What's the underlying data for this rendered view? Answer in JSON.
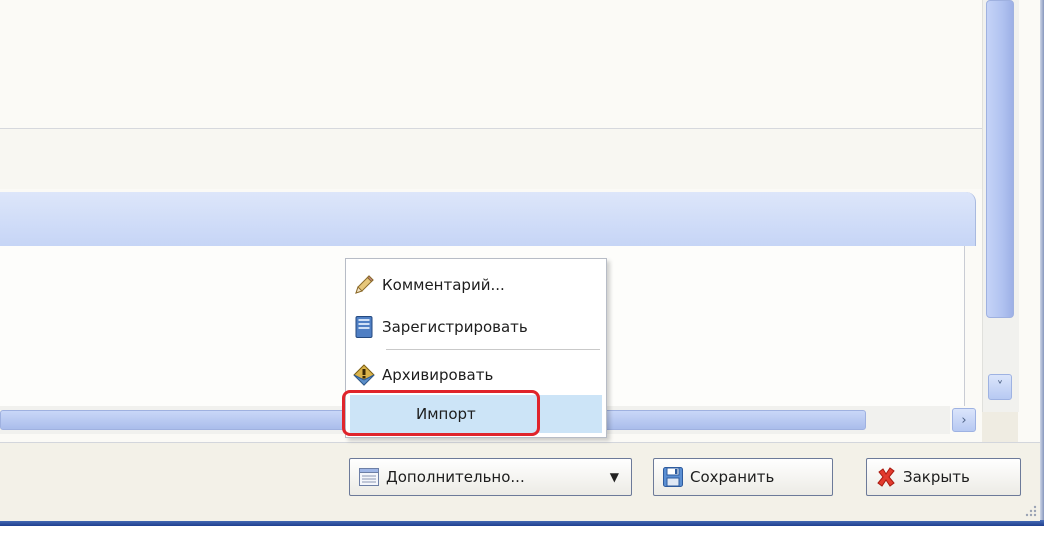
{
  "menu": {
    "items": [
      {
        "label": "Комментарий...",
        "icon": "pencil-icon"
      },
      {
        "label": "Зарегистрировать",
        "icon": "register-book-icon"
      },
      {
        "label": "Архивировать",
        "icon": "archive-icon"
      },
      {
        "label": "Импорт",
        "icon": ""
      }
    ],
    "highlighted": "Импорт",
    "highlight_color": "#cce4f7",
    "callout_color": "#e0242b"
  },
  "buttons": {
    "more_label": "Дополнительно...",
    "more_icon": "list-icon",
    "save_label": "Сохранить",
    "save_icon": "save-disk-icon",
    "close_label": "Закрыть",
    "close_icon": "red-x-icon"
  },
  "scrollbars": {
    "down_arrow": "˅",
    "right_arrow": "›"
  },
  "colors": {
    "frame_blue": "#1f3f8f",
    "grid_header": "#c6d5f6",
    "scroll_thumb": "#b0c2f0"
  }
}
